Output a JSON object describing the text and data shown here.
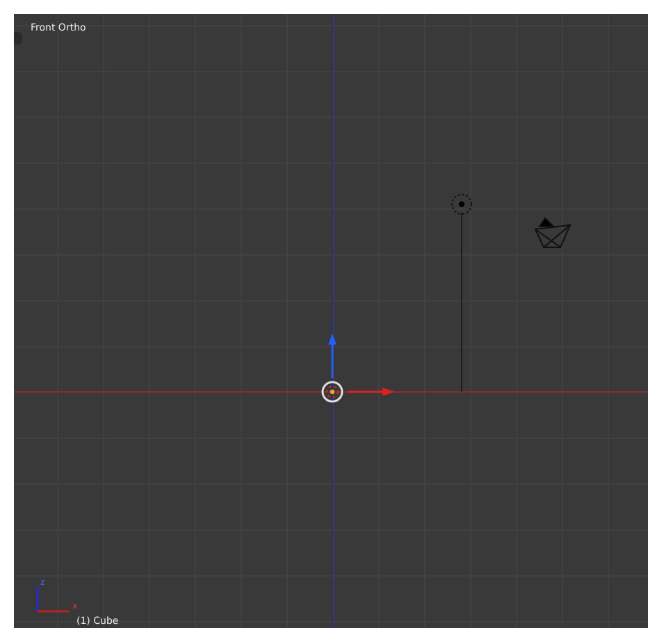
{
  "viewport": {
    "title": "Front Ortho",
    "axis_labels": [
      "x",
      "z"
    ],
    "object_label": "(1) Cube"
  }
}
